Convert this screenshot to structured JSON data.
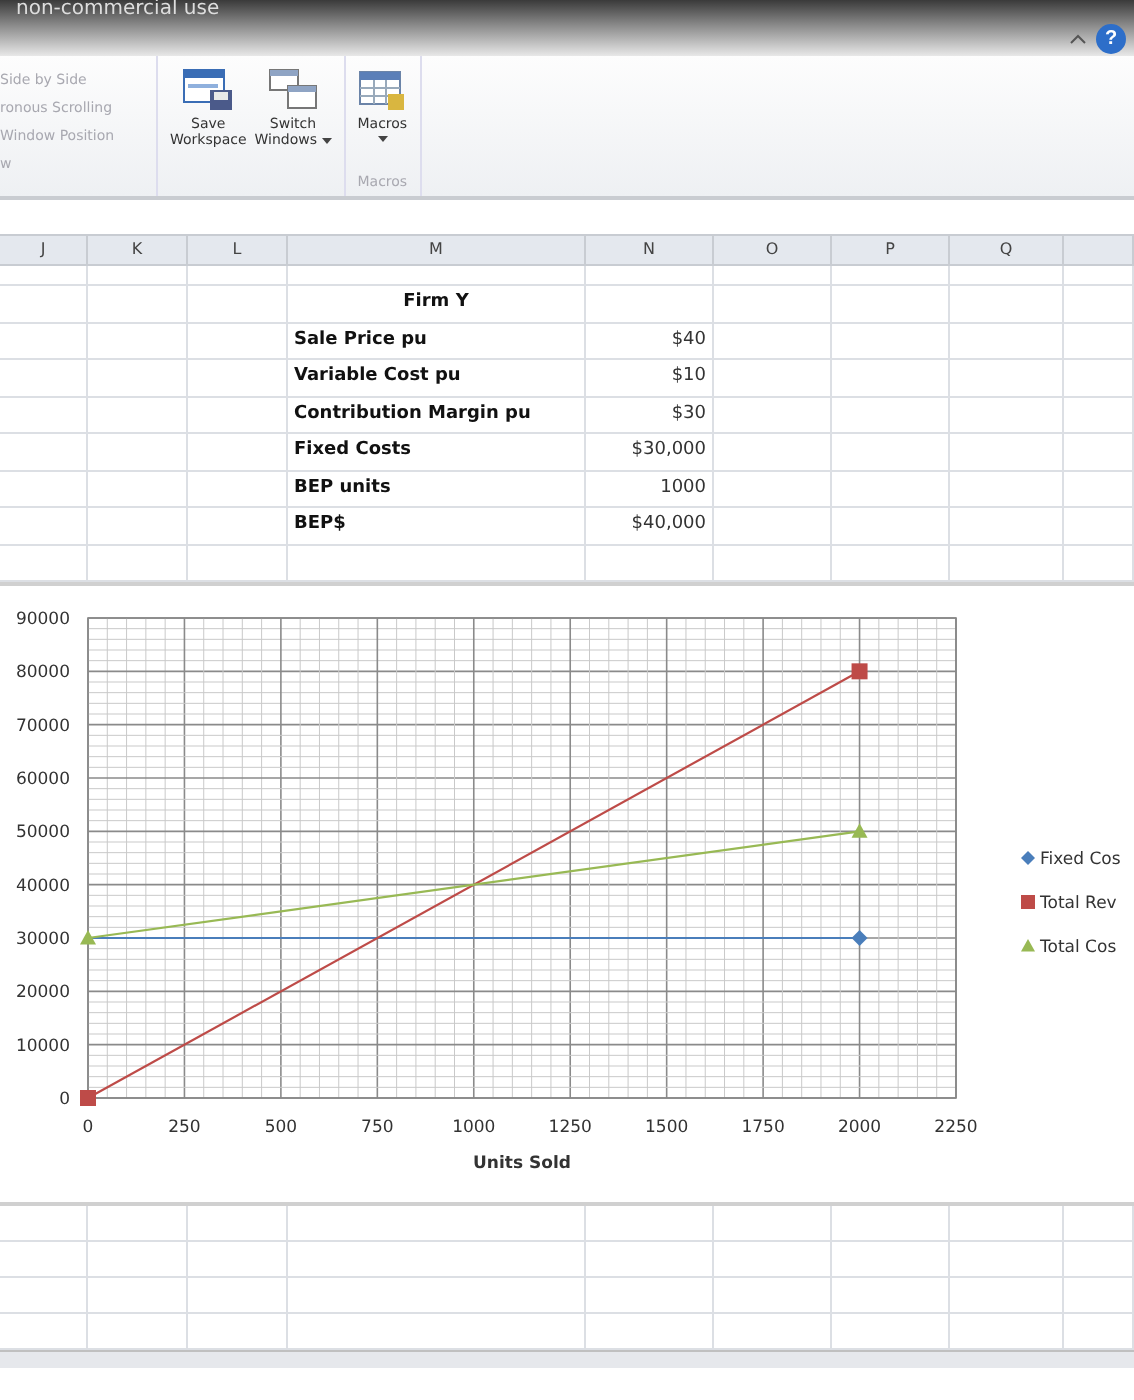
{
  "window": {
    "title": "non-commercial use",
    "help_button": {
      "label": "?"
    }
  },
  "ribbon": {
    "window_group": {
      "items": [
        "Side by Side",
        "ronous Scrolling",
        "Window Position"
      ],
      "label": "w"
    },
    "buttons": [
      {
        "label": "Save Workspace",
        "kind": "save",
        "dropdown": false
      },
      {
        "label": "Switch Windows",
        "kind": "switch",
        "dropdown": true
      }
    ],
    "macros_group": {
      "button": {
        "label": "Macros",
        "dropdown": true
      },
      "label": "Macros"
    }
  },
  "columns": [
    "J",
    "K",
    "L",
    "M",
    "N",
    "O",
    "P",
    "Q"
  ],
  "table": {
    "title": "Firm Y",
    "rows": [
      {
        "label": "Sale Price pu",
        "value": "$40"
      },
      {
        "label": "Variable Cost pu",
        "value": "$10"
      },
      {
        "label": "Contribution Margin pu",
        "value": "$30"
      },
      {
        "label": "Fixed Costs",
        "value": "$30,000"
      },
      {
        "label": "BEP units",
        "value": "1000"
      },
      {
        "label": "BEP$",
        "value": "$40,000"
      }
    ]
  },
  "chart_data": {
    "type": "line",
    "grid": true,
    "legend": true,
    "xlabel": "Units Sold",
    "x": [
      0,
      2000
    ],
    "xlim": [
      0,
      2250
    ],
    "ylim": [
      0,
      90000
    ],
    "xticks": [
      0,
      250,
      500,
      750,
      1000,
      1250,
      1500,
      1750,
      2000,
      2250
    ],
    "yticks": [
      0,
      10000,
      20000,
      30000,
      40000,
      50000,
      60000,
      70000,
      80000,
      90000
    ],
    "series": [
      {
        "name": "Fixed Cos",
        "color": "#4a7ebb",
        "marker": "diamond",
        "values": [
          30000,
          30000
        ]
      },
      {
        "name": "Total Rev",
        "color": "#be4b48",
        "marker": "square",
        "values": [
          0,
          80000
        ]
      },
      {
        "name": "Total Cos",
        "color": "#98b954",
        "marker": "triangle",
        "values": [
          30000,
          50000
        ]
      }
    ]
  }
}
